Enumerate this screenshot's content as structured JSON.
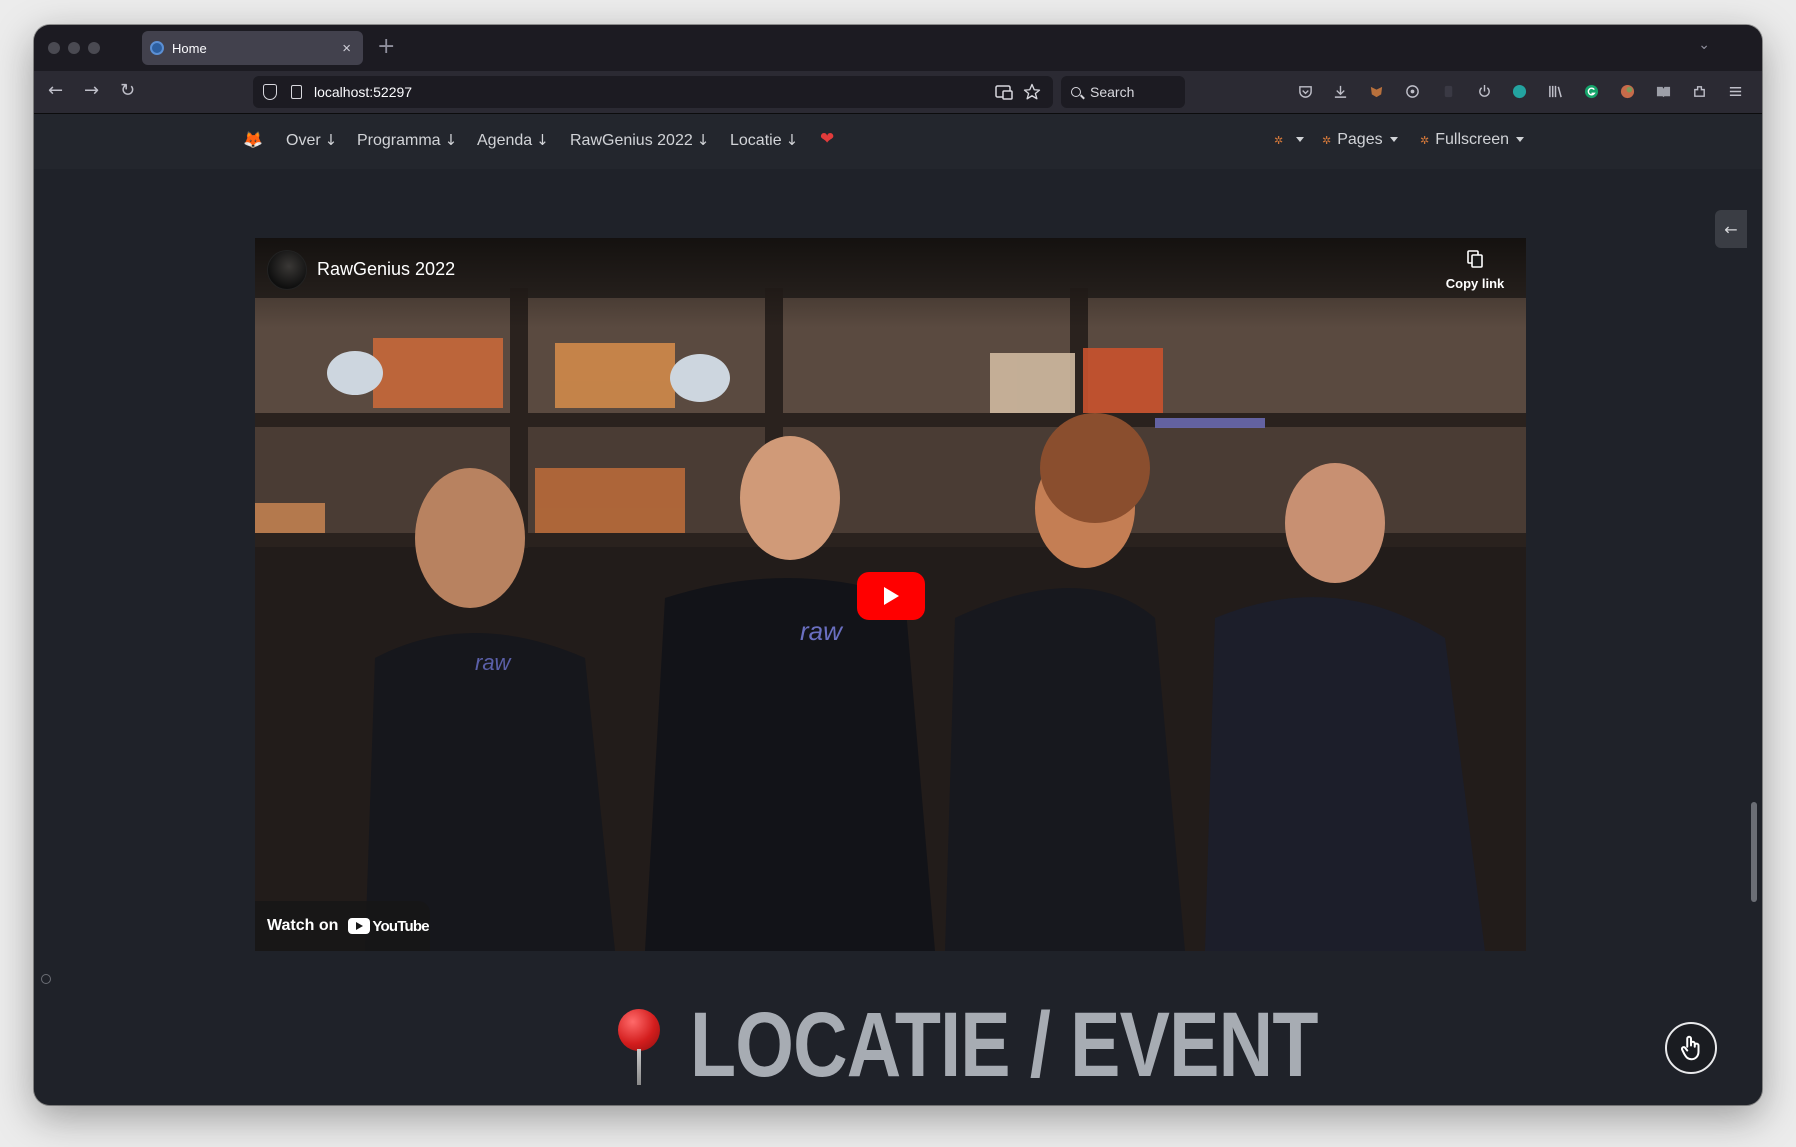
{
  "browser": {
    "tab_title": "Home",
    "tab_close": "×",
    "new_tab": "+",
    "tab_list": "⌄",
    "url": "localhost:52297",
    "search_label": "Search",
    "back": "←",
    "forward": "→",
    "reload": "↻"
  },
  "site_nav": {
    "logo": "🦊",
    "items": [
      {
        "label": "Over",
        "arrow": "↓"
      },
      {
        "label": "Programma",
        "arrow": "↓"
      },
      {
        "label": "Agenda",
        "arrow": "↓"
      },
      {
        "label": "RawGenius 2022",
        "arrow": "↓"
      },
      {
        "label": "Locatie",
        "arrow": "↓"
      }
    ],
    "heart": "❤",
    "right_menu": {
      "pages_label": "Pages",
      "fullscreen_label": "Fullscreen"
    }
  },
  "side_toggle": "←",
  "video": {
    "title": "RawGenius 2022",
    "copy_link": "Copy link",
    "watch_on": "Watch on",
    "youtube": "YouTube"
  },
  "section": {
    "heading": "LOCATIE / EVENT"
  },
  "colors": {
    "page_bg": "#1f2229",
    "nav_bg": "#23262d",
    "heading": "#a7acb3",
    "youtube_red": "#ff0000"
  }
}
